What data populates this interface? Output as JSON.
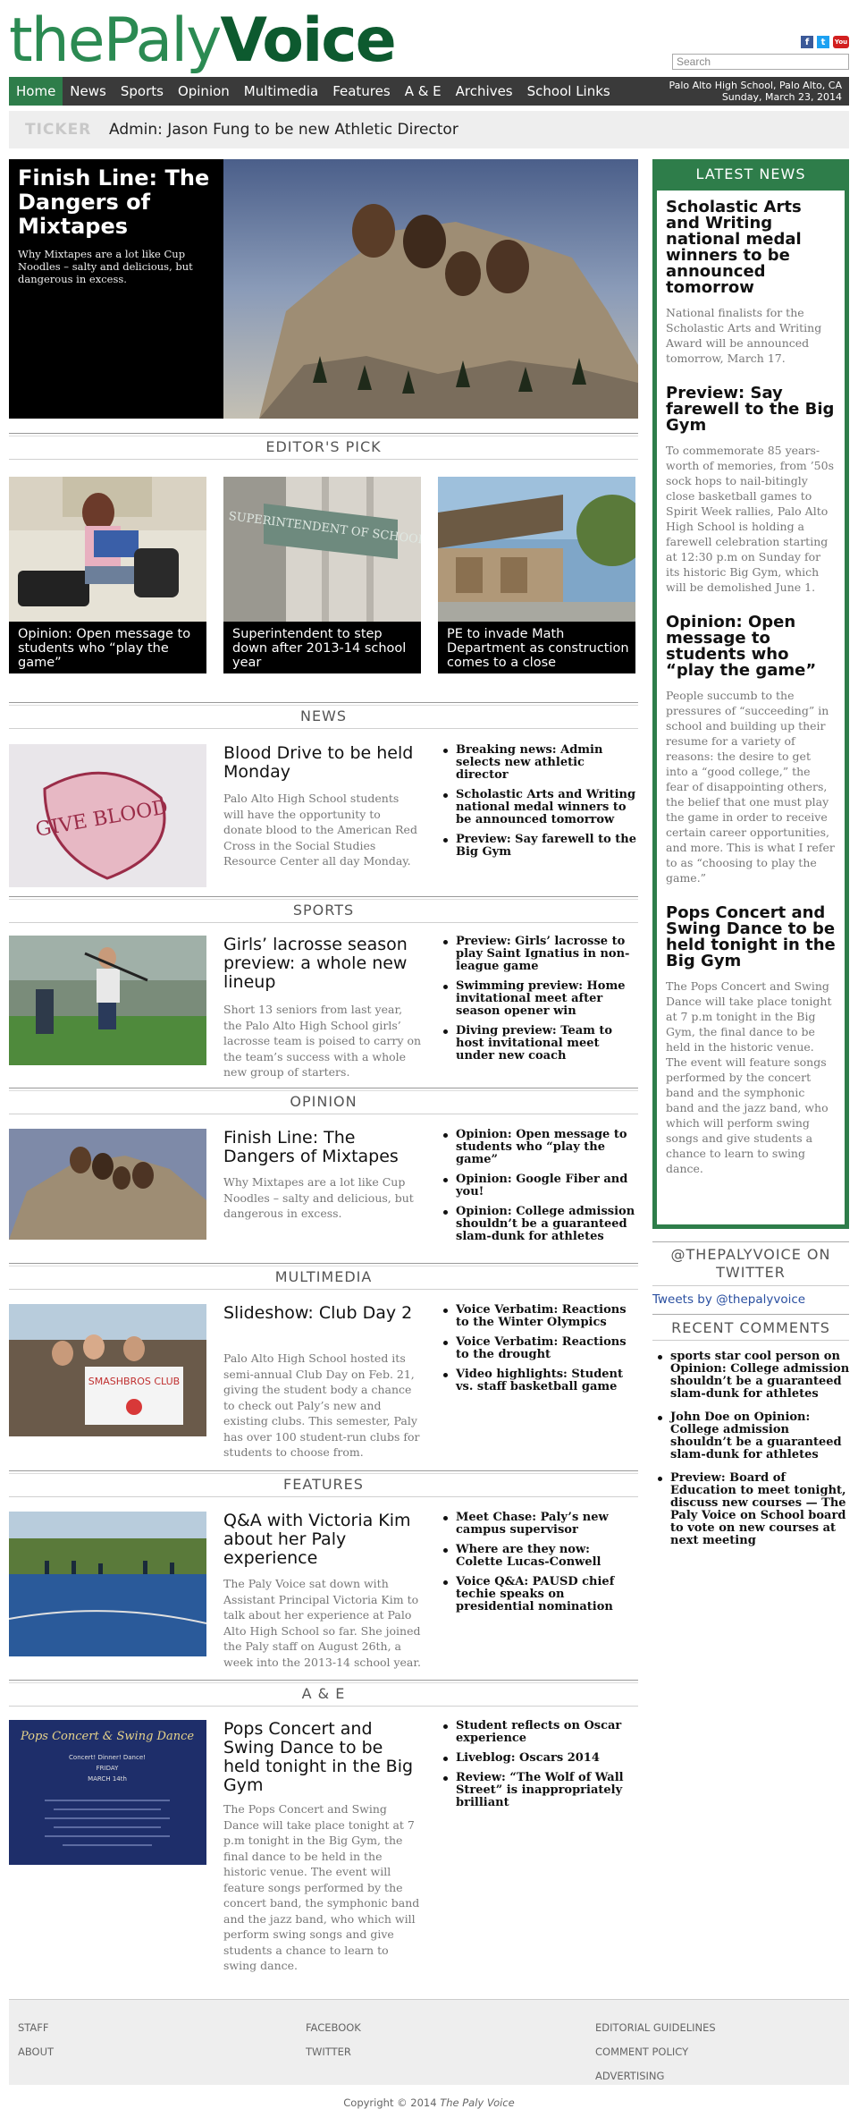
{
  "header": {
    "logo_the": "the",
    "logo_paly": "Paly",
    "logo_voice": "Voice",
    "search_placeholder": "Search",
    "social": [
      "f",
      "t",
      "You"
    ]
  },
  "nav": {
    "items": [
      "Home",
      "News",
      "Sports",
      "Opinion",
      "Multimedia",
      "Features",
      "A & E",
      "Archives",
      "School Links"
    ],
    "location": "Palo Alto High School, Palo Alto, CA",
    "date": "Sunday, March 23, 2014"
  },
  "ticker": {
    "label": "TICKER",
    "text": "Admin: Jason Fung to be new Athletic Director"
  },
  "hero": {
    "title": "Finish Line: The Dangers of Mixtapes",
    "desc": "Why Mixtapes are a lot like Cup Noodles – salty and delicious, but dangerous in excess."
  },
  "editors_pick": {
    "heading": "EDITOR'S PICK",
    "items": [
      "Opinion: Open message to students who “play the game”",
      "Superintendent to step down after 2013-14 school year",
      "PE to invade Math Department as construction comes to a close"
    ],
    "sign_text": "SUPERINTENDENT OF SCHOOLS"
  },
  "sections": {
    "news": {
      "heading": "NEWS",
      "title": "Blood Drive to be held Monday",
      "desc": "Palo Alto High School students will have the opportunity to donate blood to the American Red Cross in the Social Studies Resource Center all day Monday.",
      "image_text": "GIVE BLOOD",
      "list": [
        "Breaking news: Admin selects new athletic director",
        "Scholastic Arts and Writing national medal winners to be announced tomorrow",
        "Preview: Say farewell to the Big Gym"
      ]
    },
    "sports": {
      "heading": "SPORTS",
      "title": "Girls’ lacrosse season preview: a whole new lineup",
      "desc": "Short 13 seniors from last year, the Palo Alto High School girls’ lacrosse team is poised to carry on the team’s success with a whole new group of starters.",
      "list": [
        "Preview: Girls’ lacrosse to play Saint Ignatius in non-league game",
        "Swimming preview: Home invitational meet after season opener win",
        "Diving preview: Team to host invitational meet under new coach"
      ]
    },
    "opinion": {
      "heading": "OPINION",
      "title": "Finish Line: The Dangers of Mixtapes",
      "desc": "Why Mixtapes are a lot like Cup Noodles – salty and delicious, but dangerous in excess.",
      "list": [
        "Opinion: Open message to students who “play the game”",
        "Opinion: Google Fiber and you!",
        "Opinion: College admission shouldn’t be a guaranteed slam-dunk for athletes"
      ]
    },
    "multimedia": {
      "heading": "MULTIMEDIA",
      "title": "Slideshow: Club Day 2",
      "desc": "Palo Alto High School hosted its semi-annual Club Day on Feb. 21, giving the student body a chance to check out Paly’s new and existing clubs. This semester, Paly has over 100 student-run clubs for students to choose from.",
      "image_text": "SMASHBROS CLUB",
      "list": [
        "Voice Verbatim: Reactions to the Winter Olympics",
        "Voice Verbatim: Reactions to the drought",
        "Video highlights: Student vs. staff basketball game"
      ]
    },
    "features": {
      "heading": "FEATURES",
      "title": "Q&A with Victoria Kim about her Paly experience",
      "desc": "The Paly Voice sat down with Assistant Principal Victoria Kim to talk about her experience at Palo Alto High School so far. She joined the Paly staff on August 26th, a week into the 2013-14 school year.",
      "list": [
        "Meet Chase: Paly’s new campus supervisor",
        "Where are they now: Colette Lucas-Conwell",
        "Voice Q&A: PAUSD chief techie speaks on presidential nomination"
      ]
    },
    "ae": {
      "heading": "A & E",
      "title": "Pops Concert and Swing Dance to be held tonight in the Big Gym",
      "desc": "The Pops Concert and Swing Dance will take place tonight at 7 p.m tonight in the Big Gym, the final dance to be held in the historic venue. The event will feature songs performed by the concert band, the symphonic band and the jazz band, who which will perform swing songs and give students a chance to learn to swing dance.",
      "poster_title": "Pops Concert & Swing Dance",
      "poster_sub": "Concert! Dinner! Dance!",
      "poster_day": "FRIDAY",
      "poster_date": "MARCH 14th",
      "list": [
        "Student reflects on Oscar experience",
        "Liveblog: Oscars 2014",
        "Review: “The Wolf of Wall Street” is inappropriately brilliant"
      ]
    }
  },
  "latest_news": {
    "heading": "LATEST NEWS",
    "stories": [
      {
        "title": "Scholastic Arts and Writing national medal winners to be announced tomorrow",
        "desc": "National finalists for the Scholastic Arts and Writing Award will be announced tomorrow, March 17."
      },
      {
        "title": "Preview: Say farewell to the Big Gym",
        "desc": "To commemorate 85 years-worth of memories, from ’50s sock hops to nail-bitingly close basketball games to Spirit Week rallies, Palo Alto High School is holding a farewell celebration starting at 12:30 p.m on Sunday for its historic Big Gym, which will be demolished June 1."
      },
      {
        "title": "Opinion: Open message to students who “play the game”",
        "desc": "People succumb to the pressures of “succeeding” in school and building up their resume for a variety of reasons: the desire to get into a “good college,” the fear of disappointing others, the belief that one must play the game in order to receive certain career opportunities, and more. This is what I refer to as “choosing to play the game.”"
      },
      {
        "title": "Pops Concert and Swing Dance to be held tonight in the Big Gym",
        "desc": "The Pops Concert and Swing Dance will take place tonight at 7 p.m tonight in the Big Gym, the final dance to be held in the historic venue. The event will feature songs performed by the concert band and the symphonic band and the jazz band, who which will perform swing songs and give students a chance to learn to swing dance."
      }
    ]
  },
  "twitter": {
    "heading": "@THEPALYVOICE ON TWITTER",
    "link": "Tweets by @thepalyvoice"
  },
  "recent_comments": {
    "heading": "RECENT COMMENTS",
    "items": [
      "sports star cool person on Opinion: College admission shouldn’t be a guaranteed slam-dunk for athletes",
      "John Doe on Opinion: College admission shouldn’t be a guaranteed slam-dunk for athletes",
      "Preview: Board of Education to meet tonight, discuss new courses — The Paly Voice on School board to vote on new courses at next meeting"
    ]
  },
  "footer": {
    "col1": [
      "STAFF",
      "ABOUT"
    ],
    "col2": [
      "FACEBOOK",
      "TWITTER"
    ],
    "col3": [
      "EDITORIAL GUIDELINES",
      "COMMENT POLICY",
      "ADVERTISING"
    ],
    "copyright": "Copyright © 2014",
    "copyright_name": "The Paly Voice"
  },
  "colors": {
    "brand_green": "#2e7d4a",
    "logo_dark_green": "#0d5a2f",
    "nav_bg": "#3a3a3a",
    "twitter_link": "#2a4fa0"
  }
}
